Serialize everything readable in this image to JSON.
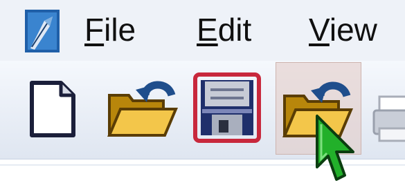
{
  "menubar": {
    "items": [
      {
        "label_mnemonic": "F",
        "label_rest": "ile"
      },
      {
        "label_mnemonic": "E",
        "label_rest": "dit"
      },
      {
        "label_mnemonic": "V",
        "label_rest": "iew"
      }
    ]
  },
  "toolbar": {
    "buttons": [
      {
        "icon": "new-document-icon",
        "state": "normal"
      },
      {
        "icon": "open-folder-icon",
        "state": "normal"
      },
      {
        "icon": "save-floppy-icon",
        "state": "highlighted"
      },
      {
        "icon": "reopen-folder-icon",
        "state": "hover"
      },
      {
        "icon": "print-icon",
        "state": "partially-visible"
      }
    ]
  },
  "colors": {
    "menubar_bg": "#eef2f8",
    "toolbar_bg": "#e9eef6",
    "save_highlight": "#c8283c",
    "hover_bg": "#e1c8c3",
    "cursor_green": "#22b02a"
  }
}
